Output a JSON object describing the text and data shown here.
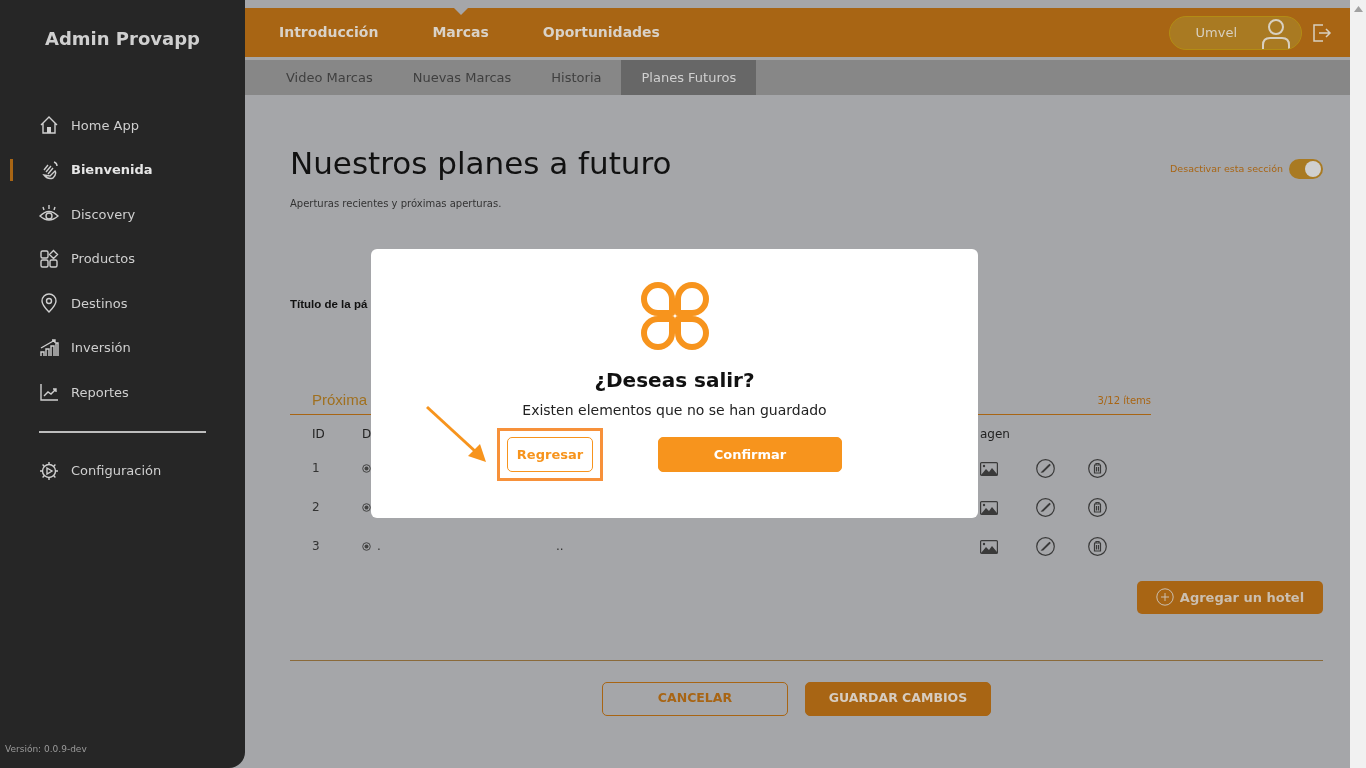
{
  "sidebar": {
    "title": "Admin Provapp",
    "items": [
      {
        "label": "Home App",
        "selected": false
      },
      {
        "label": "Bienvenida",
        "selected": true
      },
      {
        "label": "Discovery",
        "selected": false
      },
      {
        "label": "Productos",
        "selected": false
      },
      {
        "label": "Destinos",
        "selected": false
      },
      {
        "label": "Inversión",
        "selected": false
      },
      {
        "label": "Reportes",
        "selected": false
      }
    ],
    "footer_items": [
      {
        "label": "Configuración",
        "selected": false
      }
    ],
    "version": "Versión: 0.0.9-dev"
  },
  "top_tabs": [
    {
      "label": "Introducción",
      "selected": false
    },
    {
      "label": "Marcas",
      "selected": true
    },
    {
      "label": "Oportunidades",
      "selected": false
    }
  ],
  "user": {
    "name": "Umvel"
  },
  "sub_tabs": [
    {
      "label": "Video Marcas",
      "selected": false
    },
    {
      "label": "Nuevas Marcas",
      "selected": false
    },
    {
      "label": "Historia",
      "selected": false
    },
    {
      "label": "Planes Futuros",
      "selected": true
    }
  ],
  "page": {
    "title": "Nuestros planes a futuro",
    "subtitle": "Aperturas recientes y próximas aperturas.",
    "toggle": {
      "label": "Desactivar esta sección",
      "on": true
    },
    "field_label": "Título de la pá",
    "list_title": "Próxima",
    "count": "3/12 ítems",
    "columns": [
      "ID",
      "D",
      "agen"
    ],
    "rows": [
      {
        "id": "1"
      },
      {
        "id": "2"
      },
      {
        "id": "3",
        "texts": [
          ".",
          ".."
        ]
      }
    ],
    "add_button": "Agregar un hotel"
  },
  "footer_buttons": [
    {
      "label": "CANCELAR",
      "kind": "outline"
    },
    {
      "label": "GUARDAR CAMBIOS",
      "kind": "solid"
    }
  ],
  "dialog": {
    "title": "¿Deseas salir?",
    "message": "Existen elementos que no se han guardado",
    "buttons": [
      {
        "label": "Regresar",
        "kind": "outline",
        "highlighted": true
      },
      {
        "label": "Confirmar",
        "kind": "solid"
      }
    ]
  }
}
